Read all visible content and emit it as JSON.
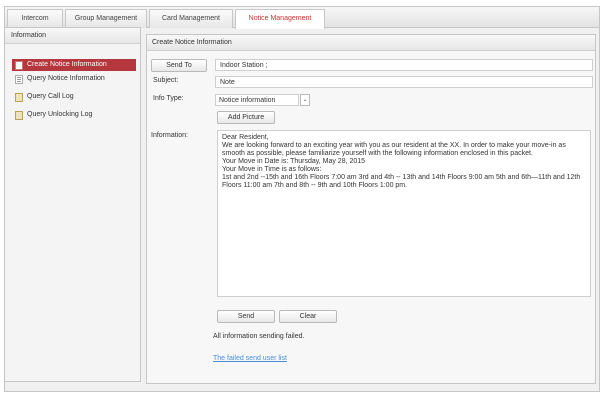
{
  "tabs": [
    {
      "label": "Intercom",
      "active": false
    },
    {
      "label": "Group Management",
      "active": false
    },
    {
      "label": "Card Management",
      "active": false
    },
    {
      "label": "Notice Management",
      "active": true
    }
  ],
  "sidebar": {
    "title": "Information",
    "items": [
      {
        "label": "Create Notice Information",
        "icon": "document-icon",
        "active": true
      },
      {
        "label": "Query Notice Information",
        "icon": "list-icon",
        "active": false
      },
      {
        "label": "Query Call Log",
        "icon": "log-icon",
        "active": false
      },
      {
        "label": "Query Unlocking Log",
        "icon": "log-icon",
        "active": false
      }
    ]
  },
  "main": {
    "title": "Create Notice Information",
    "send_to": {
      "button": "Send To",
      "value": "Indoor Station ;"
    },
    "subject": {
      "label": "Subject:",
      "value": "Note"
    },
    "info_type": {
      "label": "Info Type:",
      "value": "Notice information"
    },
    "add_picture": "Add Picture",
    "information": {
      "label": "Information:",
      "lines": [
        "Dear Resident,",
        "We are looking forward to an exciting year with you as our resident at the XX. In order to make your move-in as",
        "smooth as possible, please familiarize yourself with the following information enclosed in this packet.",
        "Your Move in Date is: Thursday, May 28, 2015",
        "Your Move in Time is as follows:",
        "1st and 2nd --15th and 16th Floors 7:00 am 3rd and 4th -- 13th and 14th Floors 9:00 am 5th and 6th—11th and 12th",
        "Floors 11:00 am 7th and 8th -- 9th and 10th Floors 1:00 pm."
      ]
    },
    "send_button": "Send",
    "clear_button": "Clear",
    "status": "All information sending failed.",
    "failed_link": "The failed send user list"
  },
  "colors": {
    "accent": "#b3373c",
    "active_tab_text": "#cc3333",
    "link": "#4a8fd4"
  }
}
